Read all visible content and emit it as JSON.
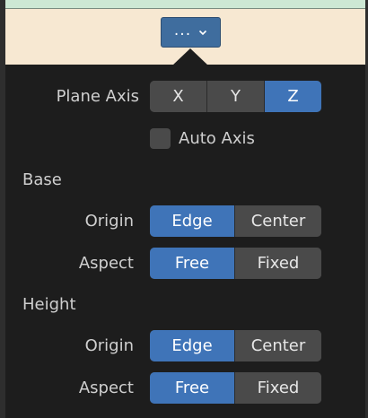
{
  "trigger": {
    "label": "...",
    "chevron_icon": "chevron-down-icon"
  },
  "plane_axis": {
    "label": "Plane Axis",
    "options": [
      "X",
      "Y",
      "Z"
    ],
    "selected": "Z"
  },
  "auto_axis": {
    "label": "Auto Axis",
    "checked": false
  },
  "base": {
    "title": "Base",
    "origin": {
      "label": "Origin",
      "options": [
        "Edge",
        "Center"
      ],
      "selected": "Edge"
    },
    "aspect": {
      "label": "Aspect",
      "options": [
        "Free",
        "Fixed"
      ],
      "selected": "Free"
    }
  },
  "height": {
    "title": "Height",
    "origin": {
      "label": "Origin",
      "options": [
        "Edge",
        "Center"
      ],
      "selected": "Edge"
    },
    "aspect": {
      "label": "Aspect",
      "options": [
        "Free",
        "Fixed"
      ],
      "selected": "Free"
    }
  },
  "colors": {
    "accent": "#3f74b8",
    "panel": "#1d1d1d",
    "segment": "#4a4a4a"
  }
}
